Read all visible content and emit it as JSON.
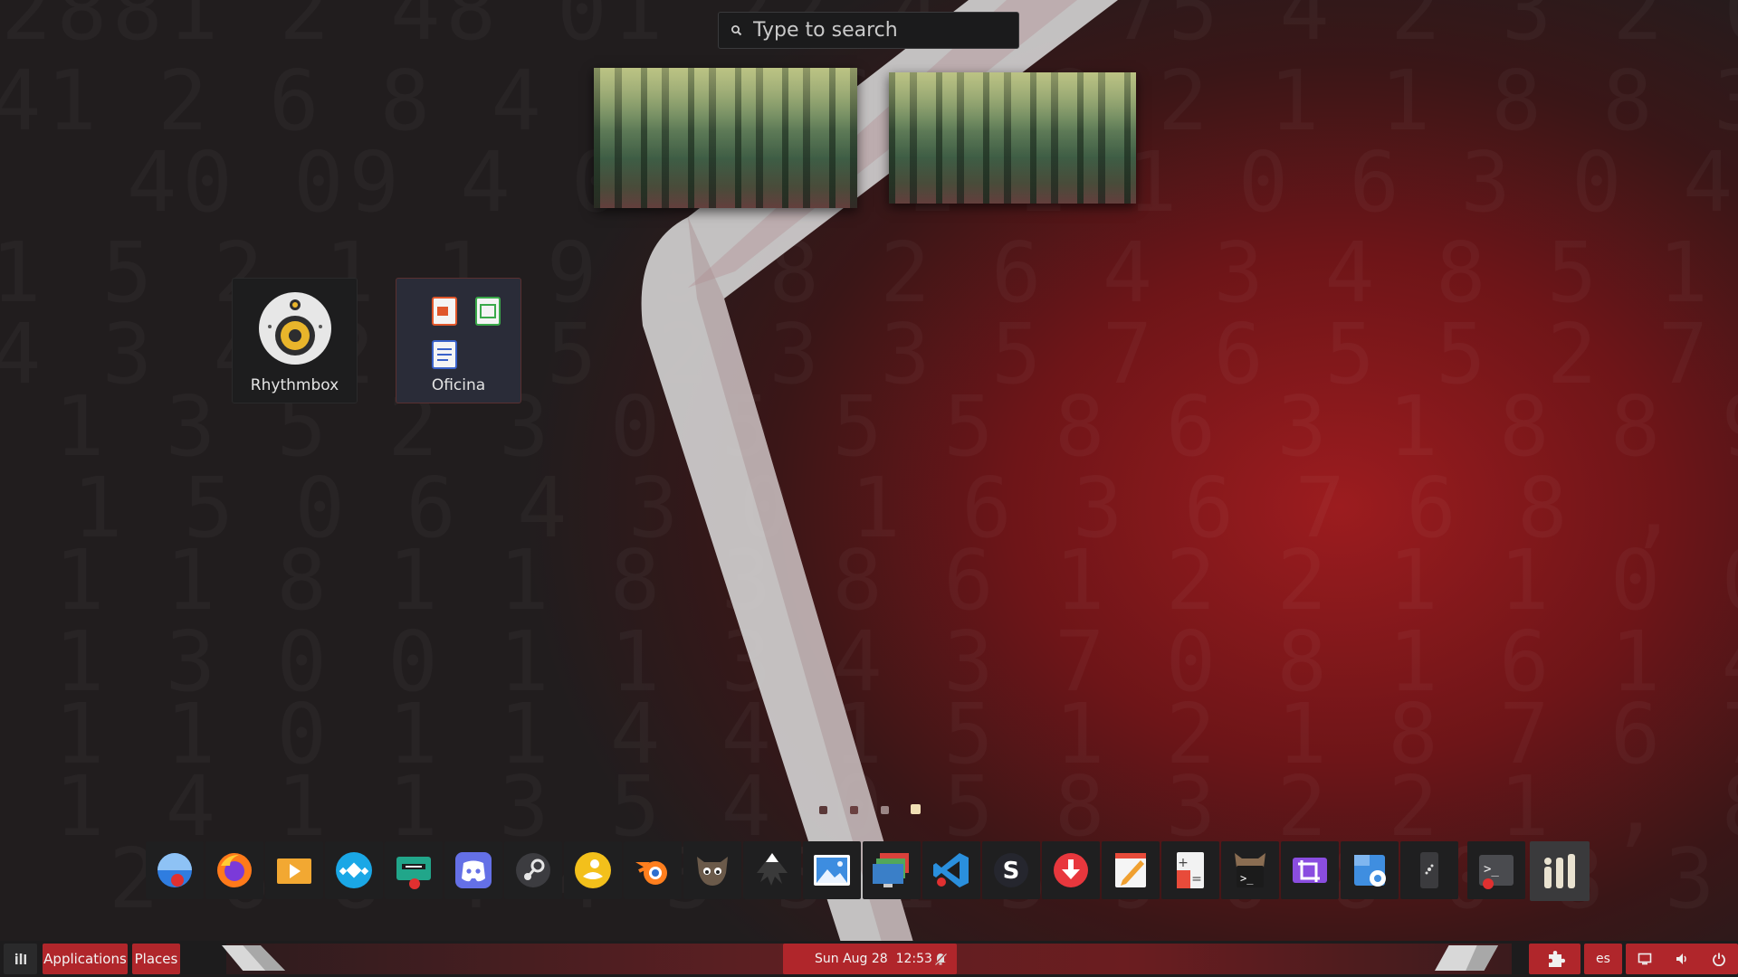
{
  "search": {
    "placeholder": "Type to search"
  },
  "workspaces": [
    {
      "name": "workspace-1"
    },
    {
      "name": "workspace-2"
    }
  ],
  "app_grid": [
    {
      "label": "Rhythmbox",
      "icon": "rhythmbox-icon"
    },
    {
      "label": "Oficina",
      "icon": "folder-oficina-icon"
    }
  ],
  "pages": {
    "count": 4,
    "current": 4
  },
  "dock": [
    {
      "name": "finder-icon"
    },
    {
      "name": "firefox-icon"
    },
    {
      "name": "video-player-icon"
    },
    {
      "name": "kodi-icon"
    },
    {
      "name": "gpu-monitor-icon"
    },
    {
      "name": "discord-icon"
    },
    {
      "name": "steam-icon"
    },
    {
      "name": "yellow-duck-icon"
    },
    {
      "name": "blender-icon"
    },
    {
      "name": "gimp-icon"
    },
    {
      "name": "inkscape-icon"
    },
    {
      "name": "image-viewer-icon"
    },
    {
      "name": "remote-desktop-icon"
    },
    {
      "name": "vscode-icon"
    },
    {
      "name": "steam-s-icon"
    },
    {
      "name": "download-icon"
    },
    {
      "name": "text-editor-icon"
    },
    {
      "name": "calculator-icon"
    },
    {
      "name": "terminal-gnu-icon"
    },
    {
      "name": "crop-tool-icon"
    },
    {
      "name": "disks-icon"
    },
    {
      "name": "phone-connect-icon"
    },
    {
      "name": "terminal-icon"
    },
    {
      "name": "show-apps-icon"
    }
  ],
  "panel": {
    "applications": "Applications",
    "places": "Places",
    "clock": "Sun Aug 28  12:53",
    "keyboard_layout": "es"
  },
  "colors": {
    "accent": "#b0262b",
    "panel": "#1d1c1d"
  }
}
